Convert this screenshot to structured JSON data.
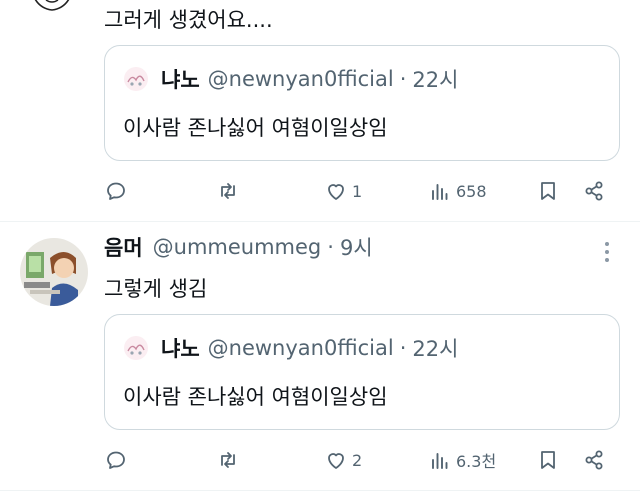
{
  "colors": {
    "text": "#0f1419",
    "muted": "#536471",
    "border": "#cfd9de",
    "divider": "#eff3f4"
  },
  "top_post": {
    "text": "그러게 생겼어요....",
    "quote": {
      "name": "냐노",
      "handle": "@newnyan0fficial",
      "separator": "·",
      "time": "22시",
      "text": "이사람 존나싫어 여혐이일상임"
    },
    "actions": {
      "reply_icon": "comment-icon",
      "retweet_icon": "retweet-icon",
      "like_count": "1",
      "views_count": "658",
      "bookmark_icon": "bookmark-icon",
      "share_icon": "share-icon"
    }
  },
  "second_post": {
    "author_name": "음머",
    "handle": "@ummeummeg",
    "separator": "·",
    "time": "9시",
    "text": "그렇게 생김",
    "quote": {
      "name": "냐노",
      "handle": "@newnyan0fficial",
      "separator": "·",
      "time": "22시",
      "text": "이사람 존나싫어 여혐이일상임"
    },
    "actions": {
      "like_count": "2",
      "views_count": "6.3천"
    }
  }
}
